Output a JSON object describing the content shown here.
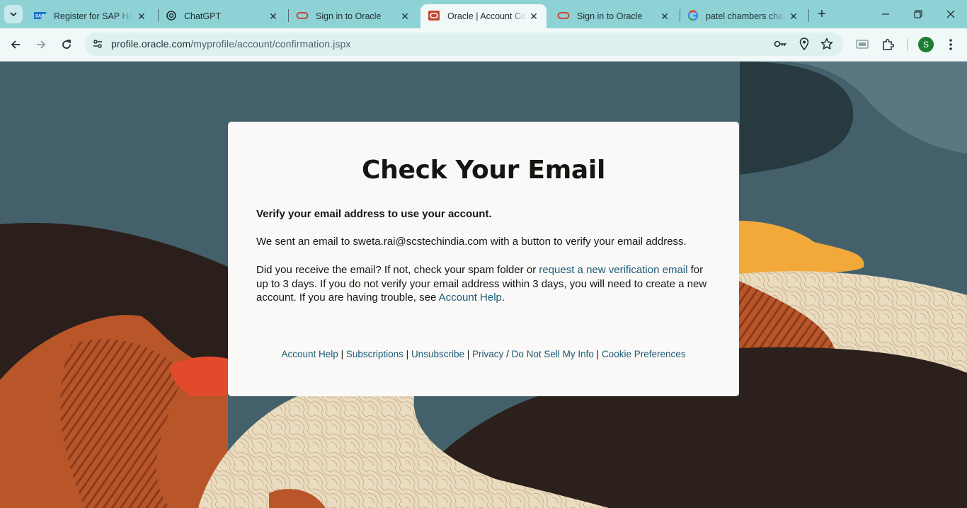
{
  "browser": {
    "tabs": [
      {
        "title": "Register for SAP HANA",
        "favicon": "sap-logo-icon",
        "active": false
      },
      {
        "title": "ChatGPT",
        "favicon": "chatgpt-logo-icon",
        "active": false
      },
      {
        "title": "Sign in to Oracle",
        "favicon": "oracle-logo-icon",
        "active": false
      },
      {
        "title": "Oracle | Account Confirmation",
        "favicon": "oracle-logo-icon",
        "active": true
      },
      {
        "title": "Sign in to Oracle",
        "favicon": "oracle-logo-icon",
        "active": false
      },
      {
        "title": "patel chambers chamber",
        "favicon": "google-logo-icon",
        "active": false
      }
    ],
    "url_host": "profile.oracle.com",
    "url_path": "/myprofile/account/confirmation.jspx",
    "profile_initial": "S",
    "colors": {
      "tab_strip": "#8fd2d6",
      "toolbar": "#f0f8f8",
      "avatar": "#1e7e34"
    }
  },
  "page": {
    "heading": "Check Your Email",
    "verify_line": "Verify your email address to use your account.",
    "sent_line": "We sent an email to sweta.rai@scstechindia.com with a button to verify your email address.",
    "para_part1": "Did you receive the email? If not, check your spam folder or ",
    "para_link1": "request a new verification email",
    "para_part2": " for up to 3 days. If you do not verify your email address within 3 days, you will need to create a new account. If you are having trouble, see ",
    "para_link2": "Account Help",
    "para_part3": ".",
    "footer": {
      "links": [
        "Account Help",
        "Subscriptions",
        "Unsubscribe",
        "Privacy",
        "Do Not Sell My Info",
        "Cookie Preferences"
      ],
      "separators": [
        "|",
        "|",
        "|",
        "/",
        "|"
      ]
    },
    "colors": {
      "link": "#1a5a78",
      "text": "#161513",
      "card": "#fbf9f7"
    }
  }
}
